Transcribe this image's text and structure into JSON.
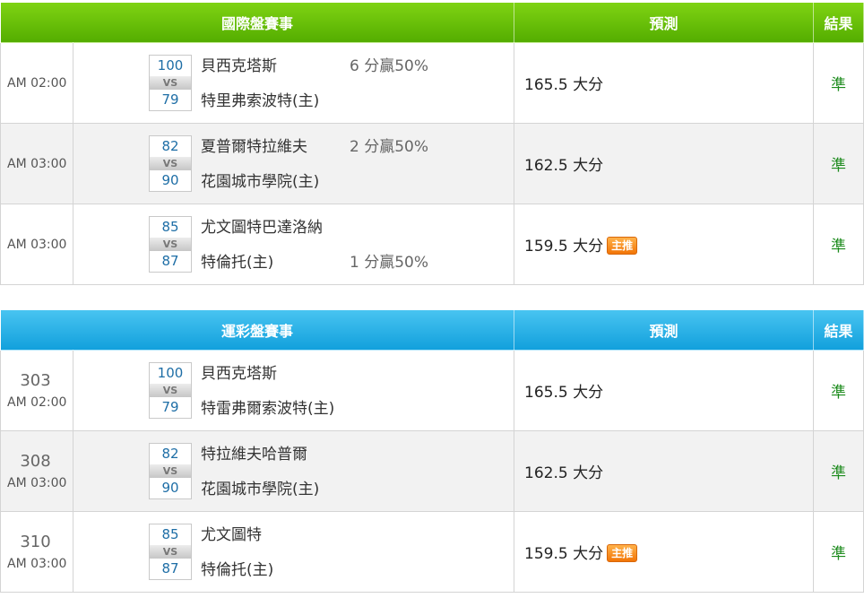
{
  "international": {
    "headers": {
      "event": "國際盤賽事",
      "prediction": "預測",
      "result": "結果"
    },
    "rows": [
      {
        "num": "",
        "time": "AM 02:00",
        "home": "貝西克塔斯",
        "away": "特里弗索波特(主)",
        "home_score": "100",
        "away_score": "79",
        "vs": "VS",
        "handicap_home": "6 分贏50%",
        "handicap_away": "",
        "prediction": "165.5 大分",
        "badge": "",
        "result": "準"
      },
      {
        "num": "",
        "time": "AM 03:00",
        "home": "夏普爾特拉維夫",
        "away": "花園城市學院(主)",
        "home_score": "82",
        "away_score": "90",
        "vs": "VS",
        "handicap_home": "2 分贏50%",
        "handicap_away": "",
        "prediction": "162.5 大分",
        "badge": "",
        "result": "準"
      },
      {
        "num": "",
        "time": "AM 03:00",
        "home": "尤文圖特巴達洛納",
        "away": "特倫托(主)",
        "home_score": "85",
        "away_score": "87",
        "vs": "VS",
        "handicap_home": "",
        "handicap_away": "1 分贏50%",
        "prediction": "159.5 大分",
        "badge": "主推",
        "result": "準"
      }
    ]
  },
  "lottery": {
    "headers": {
      "event": "運彩盤賽事",
      "prediction": "預測",
      "result": "結果"
    },
    "rows": [
      {
        "num": "303",
        "time": "AM 02:00",
        "home": "貝西克塔斯",
        "away": "特雷弗爾索波特(主)",
        "home_score": "100",
        "away_score": "79",
        "vs": "VS",
        "handicap_home": "",
        "handicap_away": "",
        "prediction": "165.5 大分",
        "badge": "",
        "result": "準"
      },
      {
        "num": "308",
        "time": "AM 03:00",
        "home": "特拉維夫哈普爾",
        "away": "花園城市學院(主)",
        "home_score": "82",
        "away_score": "90",
        "vs": "VS",
        "handicap_home": "",
        "handicap_away": "",
        "prediction": "162.5 大分",
        "badge": "",
        "result": "準"
      },
      {
        "num": "310",
        "time": "AM 03:00",
        "home": "尤文圖特",
        "away": "特倫托(主)",
        "home_score": "85",
        "away_score": "87",
        "vs": "VS",
        "handicap_home": "",
        "handicap_away": "",
        "prediction": "159.5 大分",
        "badge": "主推",
        "result": "準"
      }
    ]
  },
  "colors": {
    "intl_header": "#6cc20c",
    "lottery_header": "#2eb3e8",
    "result": "#1d8b1d",
    "score": "#1e6ea6",
    "badge": "#f58a15"
  }
}
